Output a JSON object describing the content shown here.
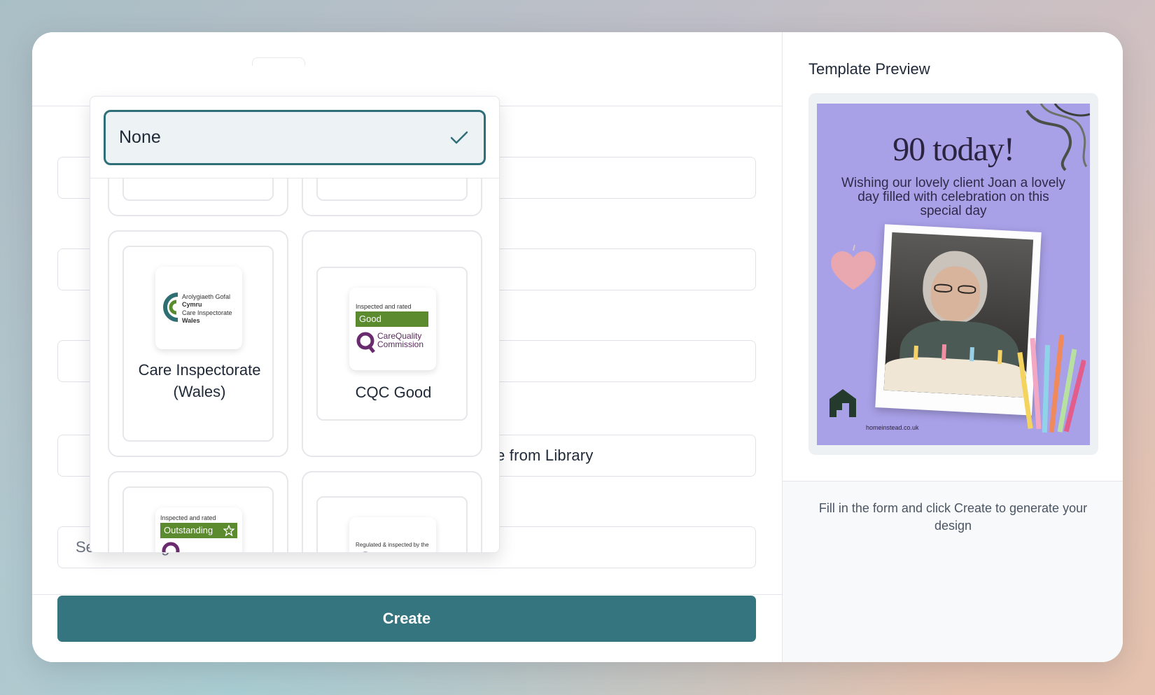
{
  "form": {
    "library_button_label": "Choose from Library",
    "badge_placeholder": "Select a badge",
    "create_label": "Create"
  },
  "badge_dropdown": {
    "selected_label": "None",
    "options": [
      {
        "label": "Care Inspectorate (Wales)",
        "logo_lines": [
          "Arolygiaeth Gofal",
          "Cymru",
          "Care Inspectorate",
          "Wales"
        ]
      },
      {
        "label": "CQC Good",
        "logo_caption": "Inspected and rated",
        "logo_rating": "Good",
        "logo_brand": [
          "CareQuality",
          "Commission"
        ]
      },
      {
        "label": "",
        "logo_caption": "Inspected and rated",
        "logo_rating": "Outstanding"
      },
      {
        "label": "",
        "logo_caption": "Regulated & inspected by the"
      }
    ]
  },
  "preview": {
    "title": "Template Preview",
    "headline": "90 today!",
    "message": "Wishing our lovely client Joan a lovely day filled with celebration on this special day",
    "website": "homeinstead.co.uk",
    "hint": "Fill in the form and click Create to generate your design"
  },
  "colors": {
    "primary": "#347580",
    "selected_border": "#2f6f7a",
    "preview_background": "#a9a1e8"
  },
  "icons": [
    "checkmark-icon",
    "star-icon",
    "home-instead-logo-icon",
    "heart-icon"
  ]
}
